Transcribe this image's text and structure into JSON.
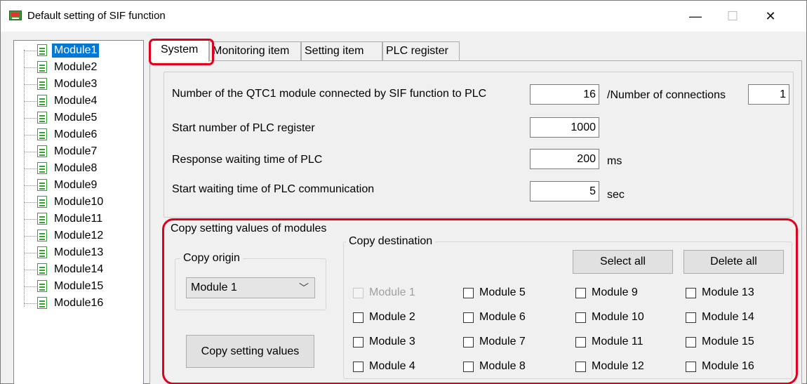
{
  "window": {
    "title": "Default setting of SIF function",
    "minimize_glyph": "—",
    "maximize_glyph": "☐",
    "close_glyph": "✕"
  },
  "tree": {
    "items": [
      {
        "label": "Module1",
        "selected": true
      },
      {
        "label": "Module2"
      },
      {
        "label": "Module3"
      },
      {
        "label": "Module4"
      },
      {
        "label": "Module5"
      },
      {
        "label": "Module6"
      },
      {
        "label": "Module7"
      },
      {
        "label": "Module8"
      },
      {
        "label": "Module9"
      },
      {
        "label": "Module10"
      },
      {
        "label": "Module11"
      },
      {
        "label": "Module12"
      },
      {
        "label": "Module13"
      },
      {
        "label": "Module14"
      },
      {
        "label": "Module15"
      },
      {
        "label": "Module16"
      }
    ]
  },
  "tabs": [
    "System",
    "Monitoring item",
    "Setting item",
    "PLC register"
  ],
  "system": {
    "modules_label": "Number of the QTC1 module connected by SIF function to PLC",
    "modules_value": "16",
    "connections_label": "/Number of connections",
    "connections_value": "1",
    "start_register_label": "Start number of PLC register",
    "start_register_value": "1000",
    "response_label": "Response waiting time of PLC",
    "response_value": "200",
    "response_unit": "ms",
    "start_wait_label": "Start waiting time of PLC communication",
    "start_wait_value": "5",
    "start_wait_unit": "sec"
  },
  "copy": {
    "group_title": "Copy setting values of modules",
    "origin_title": "Copy origin",
    "origin_value": "Module 1",
    "copy_button": "Copy setting values",
    "destination_title": "Copy destination",
    "select_all": "Select all",
    "delete_all": "Delete all",
    "destinations": [
      {
        "label": "Module 1",
        "disabled": true,
        "checked": false
      },
      {
        "label": "Module 2",
        "checked": false
      },
      {
        "label": "Module 3",
        "checked": false
      },
      {
        "label": "Module 4",
        "checked": false
      },
      {
        "label": "Module 5",
        "checked": false
      },
      {
        "label": "Module 6",
        "checked": false
      },
      {
        "label": "Module 7",
        "checked": false
      },
      {
        "label": "Module 8",
        "checked": false
      },
      {
        "label": "Module 9",
        "checked": false
      },
      {
        "label": "Module 10",
        "checked": false
      },
      {
        "label": "Module 11",
        "checked": false
      },
      {
        "label": "Module 12",
        "checked": false
      },
      {
        "label": "Module 13",
        "checked": false
      },
      {
        "label": "Module 14",
        "checked": false
      },
      {
        "label": "Module 15",
        "checked": false
      },
      {
        "label": "Module 16",
        "checked": false
      }
    ]
  },
  "colors": {
    "highlight": "#e0001b",
    "selection": "#0078d7",
    "tree_doc_icon": "#2fa52f"
  }
}
